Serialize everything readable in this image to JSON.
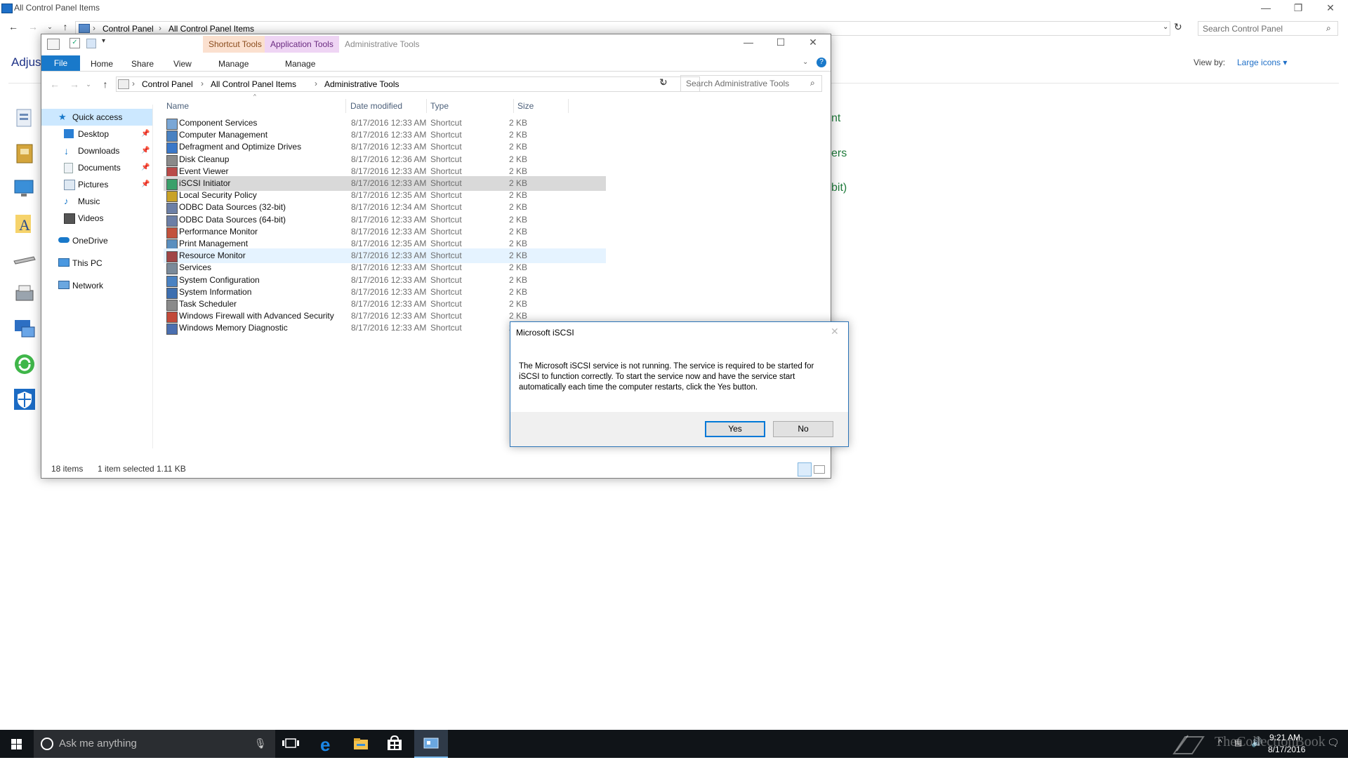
{
  "background_window": {
    "title": "All Control Panel Items",
    "breadcrumb": [
      "Control Panel",
      "All Control Panel Items"
    ],
    "search_placeholder": "Search Control Panel",
    "heading_partial": "Adjus",
    "view_by_label": "View by:",
    "view_by_value": "Large icons",
    "right_fragments": [
      "nt",
      "ers",
      "bit)"
    ]
  },
  "explorer": {
    "title": "Administrative Tools",
    "context_tabs": [
      "Shortcut Tools",
      "Application Tools"
    ],
    "ribbon_tabs": {
      "file": "File",
      "home": "Home",
      "share": "Share",
      "view": "View",
      "manage1": "Manage",
      "manage2": "Manage"
    },
    "breadcrumb": [
      "Control Panel",
      "All Control Panel Items",
      "Administrative Tools"
    ],
    "search_placeholder": "Search Administrative Tools",
    "nav": [
      {
        "label": "Quick access",
        "pinned": false
      },
      {
        "label": "Desktop",
        "pinned": true
      },
      {
        "label": "Downloads",
        "pinned": true
      },
      {
        "label": "Documents",
        "pinned": true
      },
      {
        "label": "Pictures",
        "pinned": true
      },
      {
        "label": "Music",
        "pinned": false
      },
      {
        "label": "Videos",
        "pinned": false
      },
      {
        "label": "OneDrive",
        "pinned": false
      },
      {
        "label": "This PC",
        "pinned": false
      },
      {
        "label": "Network",
        "pinned": false
      }
    ],
    "columns": {
      "name": "Name",
      "date": "Date modified",
      "type": "Type",
      "size": "Size"
    },
    "files": [
      {
        "name": "Component Services",
        "date": "8/17/2016 12:33 AM",
        "type": "Shortcut",
        "size": "2 KB"
      },
      {
        "name": "Computer Management",
        "date": "8/17/2016 12:33 AM",
        "type": "Shortcut",
        "size": "2 KB"
      },
      {
        "name": "Defragment and Optimize Drives",
        "date": "8/17/2016 12:33 AM",
        "type": "Shortcut",
        "size": "2 KB"
      },
      {
        "name": "Disk Cleanup",
        "date": "8/17/2016 12:36 AM",
        "type": "Shortcut",
        "size": "2 KB"
      },
      {
        "name": "Event Viewer",
        "date": "8/17/2016 12:33 AM",
        "type": "Shortcut",
        "size": "2 KB"
      },
      {
        "name": "iSCSI Initiator",
        "date": "8/17/2016 12:33 AM",
        "type": "Shortcut",
        "size": "2 KB"
      },
      {
        "name": "Local Security Policy",
        "date": "8/17/2016 12:35 AM",
        "type": "Shortcut",
        "size": "2 KB"
      },
      {
        "name": "ODBC Data Sources (32-bit)",
        "date": "8/17/2016 12:34 AM",
        "type": "Shortcut",
        "size": "2 KB"
      },
      {
        "name": "ODBC Data Sources (64-bit)",
        "date": "8/17/2016 12:33 AM",
        "type": "Shortcut",
        "size": "2 KB"
      },
      {
        "name": "Performance Monitor",
        "date": "8/17/2016 12:33 AM",
        "type": "Shortcut",
        "size": "2 KB"
      },
      {
        "name": "Print Management",
        "date": "8/17/2016 12:35 AM",
        "type": "Shortcut",
        "size": "2 KB"
      },
      {
        "name": "Resource Monitor",
        "date": "8/17/2016 12:33 AM",
        "type": "Shortcut",
        "size": "2 KB"
      },
      {
        "name": "Services",
        "date": "8/17/2016 12:33 AM",
        "type": "Shortcut",
        "size": "2 KB"
      },
      {
        "name": "System Configuration",
        "date": "8/17/2016 12:33 AM",
        "type": "Shortcut",
        "size": "2 KB"
      },
      {
        "name": "System Information",
        "date": "8/17/2016 12:33 AM",
        "type": "Shortcut",
        "size": "2 KB"
      },
      {
        "name": "Task Scheduler",
        "date": "8/17/2016 12:33 AM",
        "type": "Shortcut",
        "size": "2 KB"
      },
      {
        "name": "Windows Firewall with Advanced Security",
        "date": "8/17/2016 12:33 AM",
        "type": "Shortcut",
        "size": "2 KB"
      },
      {
        "name": "Windows Memory Diagnostic",
        "date": "8/17/2016 12:33 AM",
        "type": "Shortcut",
        "size": "2 KB"
      }
    ],
    "status": {
      "count": "18 items",
      "selection": "1 item selected",
      "size": "1.11 KB"
    }
  },
  "dialog": {
    "title": "Microsoft iSCSI",
    "message": "The Microsoft iSCSI service is not running. The service is required to be started for iSCSI to function correctly. To start the service now and have the service start automatically each time the computer restarts, click the Yes button.",
    "yes_label": "Yes",
    "no_label": "No"
  },
  "taskbar": {
    "search_placeholder": "Ask me anything",
    "time": "9:21 AM",
    "date": "8/17/2016",
    "watermark": "TheCollectionBook"
  },
  "colors": {
    "accent": "#1979ca",
    "selected_row": "#d9d9d9",
    "hover_row": "#e5f3ff",
    "taskbar": "#101418"
  }
}
